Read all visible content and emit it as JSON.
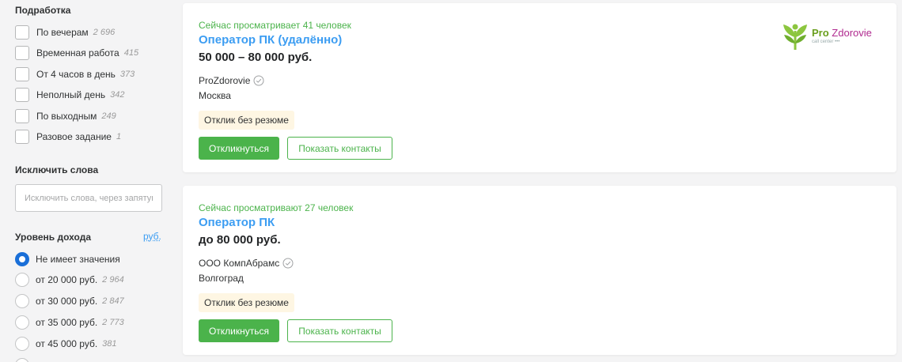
{
  "filters": {
    "parttime": {
      "title": "Подработка",
      "options": [
        {
          "label": "По вечерам",
          "count": "2 696"
        },
        {
          "label": "Временная работа",
          "count": "415"
        },
        {
          "label": "От 4 часов в день",
          "count": "373"
        },
        {
          "label": "Неполный день",
          "count": "342"
        },
        {
          "label": "По выходным",
          "count": "249"
        },
        {
          "label": "Разовое задание",
          "count": "1"
        }
      ]
    },
    "exclude_words": {
      "title": "Исключить слова",
      "placeholder": "Исключить слова, через запятую",
      "value": ""
    },
    "income": {
      "title": "Уровень дохода",
      "currency": "руб.",
      "selected_index": 0,
      "options": [
        {
          "label": "Не имеет значения",
          "count": ""
        },
        {
          "label": "от 20 000 руб.",
          "count": "2 964"
        },
        {
          "label": "от 30 000 руб.",
          "count": "2 847"
        },
        {
          "label": "от 35 000 руб.",
          "count": "2 773"
        },
        {
          "label": "от 45 000 руб.",
          "count": "381"
        }
      ]
    }
  },
  "vacancies": [
    {
      "viewers": "Сейчас просматривает 41 человек",
      "title": "Оператор ПК (удалённо)",
      "salary": "50 000 – 80 000 руб.",
      "company": "ProZdorovie",
      "city": "Москва",
      "badge": "Отклик без резюме",
      "respond_label": "Откликнуться",
      "contacts_label": "Показать контакты",
      "logo": {
        "pro": "Pro",
        "name": "Zdorovie",
        "tagline": "call center •••",
        "icon": "green-leaves-logo-icon"
      }
    },
    {
      "viewers": "Сейчас просматривают 27 человек",
      "title": "Оператор ПК",
      "salary": "до 80 000 руб.",
      "company": "ООО КомпАбрамс",
      "city": "Волгоград",
      "badge": "Отклик без резюме",
      "respond_label": "Откликнуться",
      "contacts_label": "Показать контакты"
    }
  ],
  "colors": {
    "accent_green": "#4bb34b",
    "link_blue": "#3c9df2",
    "radio_blue": "#1a6fd8",
    "badge_bg": "#fef6e3"
  }
}
